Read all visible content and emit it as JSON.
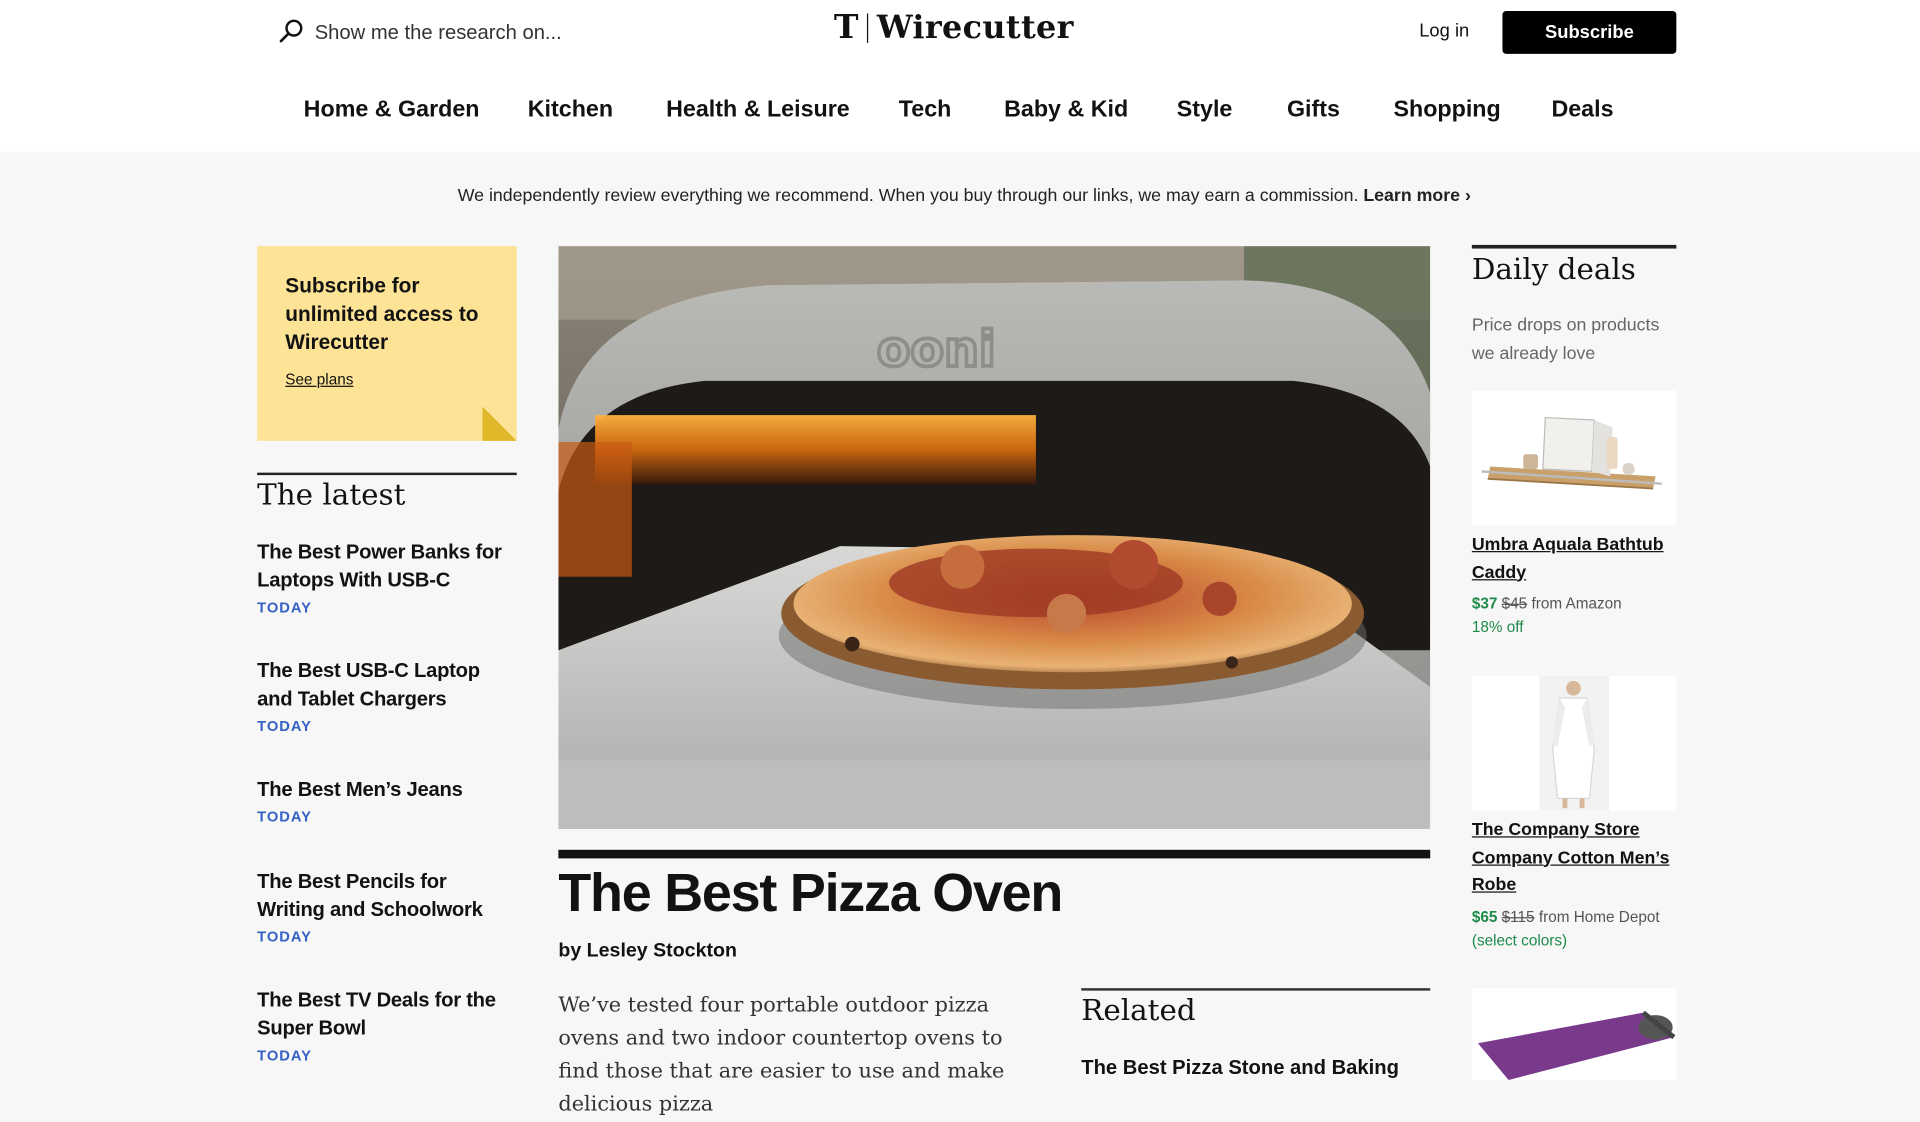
{
  "header": {
    "search_placeholder": "Show me the research on...",
    "logo_mark": "T",
    "logo_text": "Wirecutter",
    "login": "Log in",
    "subscribe": "Subscribe"
  },
  "nav": [
    "Home & Garden",
    "Kitchen",
    "Health & Leisure",
    "Tech",
    "Baby & Kid",
    "Style",
    "Gifts",
    "Shopping",
    "Deals"
  ],
  "disclaimer": {
    "text": "We independently review everything we recommend. When you buy through our links, we may earn a commission.",
    "link": "Learn more ›"
  },
  "promo": {
    "title": "Subscribe for unlimited access to Wirecutter",
    "link": "See plans"
  },
  "latest": {
    "title": "The latest",
    "items": [
      {
        "title": "The Best Power Banks for Laptops With USB-C",
        "date": "TODAY"
      },
      {
        "title": "The Best USB-C Laptop and Tablet Chargers",
        "date": "TODAY"
      },
      {
        "title": "The Best Men’s Jeans",
        "date": "TODAY"
      },
      {
        "title": "The Best Pencils for Writing and Schoolwork",
        "date": "TODAY"
      },
      {
        "title": "The Best TV Deals for the Super Bowl",
        "date": "TODAY"
      }
    ]
  },
  "hero": {
    "oven_brand": "ooni",
    "title": "The Best Pizza Oven",
    "byline": "by Lesley Stockton",
    "body": "We’ve tested four portable outdoor pizza ovens and two indoor countertop ovens to find those that are easier to use and make delicious pizza"
  },
  "related": {
    "title": "Related",
    "item": "The Best Pizza Stone and Baking"
  },
  "deals": {
    "title": "Daily deals",
    "subtitle": "Price drops on products we already love",
    "items": [
      {
        "name": "Umbra Aquala Bathtub Caddy",
        "price": "$37",
        "was": "$45",
        "source": "from Amazon",
        "extra": "18% off"
      },
      {
        "name": "The Company Store Company Cotton Men’s Robe",
        "price": "$65",
        "was": "$115",
        "source": "from Home Depot",
        "extra": "(select colors)"
      }
    ]
  },
  "colors": {
    "accent_blue": "#3460c4",
    "deal_green": "#1e8a4a",
    "promo_yellow": "#fce395"
  }
}
